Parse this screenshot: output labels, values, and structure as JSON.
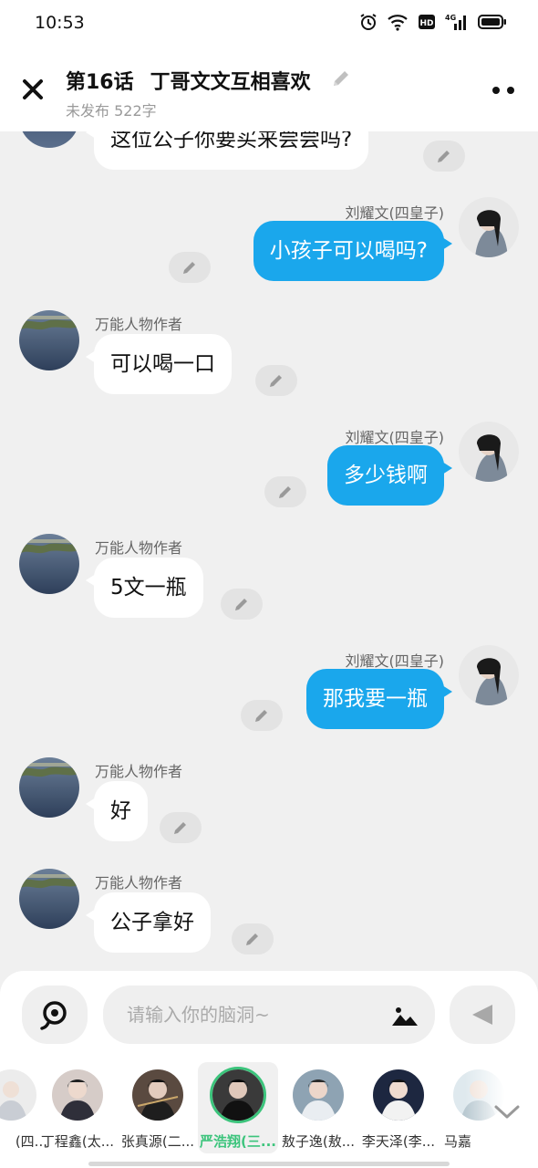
{
  "status": {
    "time": "10:53",
    "network": "4G"
  },
  "header": {
    "episode": "第16话",
    "title": "丁哥文文互相喜欢",
    "meta": "未发布 522字"
  },
  "messages": [
    {
      "side": "left",
      "sender": "",
      "text": "这位公子你要买来尝尝吗?"
    },
    {
      "side": "right",
      "sender": "刘耀文(四皇子)",
      "text": "小孩子可以喝吗?"
    },
    {
      "side": "left",
      "sender": "万能人物作者",
      "text": "可以喝一口"
    },
    {
      "side": "right",
      "sender": "刘耀文(四皇子)",
      "text": "多少钱啊"
    },
    {
      "side": "left",
      "sender": "万能人物作者",
      "text": "5文一瓶"
    },
    {
      "side": "right",
      "sender": "刘耀文(四皇子)",
      "text": "那我要一瓶"
    },
    {
      "side": "left",
      "sender": "万能人物作者",
      "text": "好"
    },
    {
      "side": "left",
      "sender": "万能人物作者",
      "text": "公子拿好"
    }
  ],
  "input": {
    "placeholder": "请输入你的脑洞~"
  },
  "characters": [
    {
      "name": "(四...",
      "active": false
    },
    {
      "name": "丁程鑫(太...",
      "active": false
    },
    {
      "name": "张真源(二...",
      "active": false
    },
    {
      "name": "严浩翔(三...",
      "active": true
    },
    {
      "name": "敖子逸(敖...",
      "active": false
    },
    {
      "name": "李天泽(李...",
      "active": false
    },
    {
      "name": "马嘉",
      "active": false
    }
  ],
  "colors": {
    "accent_blue": "#1aa7ec",
    "active_green": "#3cc47c",
    "background": "#f0f0f0"
  },
  "icons": [
    "close-icon",
    "pencil-icon",
    "more-icon",
    "voice-icon",
    "image-icon",
    "send-icon",
    "chevron-down-icon",
    "alarm-icon",
    "wifi-icon",
    "hd-icon",
    "signal-icon",
    "battery-icon"
  ]
}
